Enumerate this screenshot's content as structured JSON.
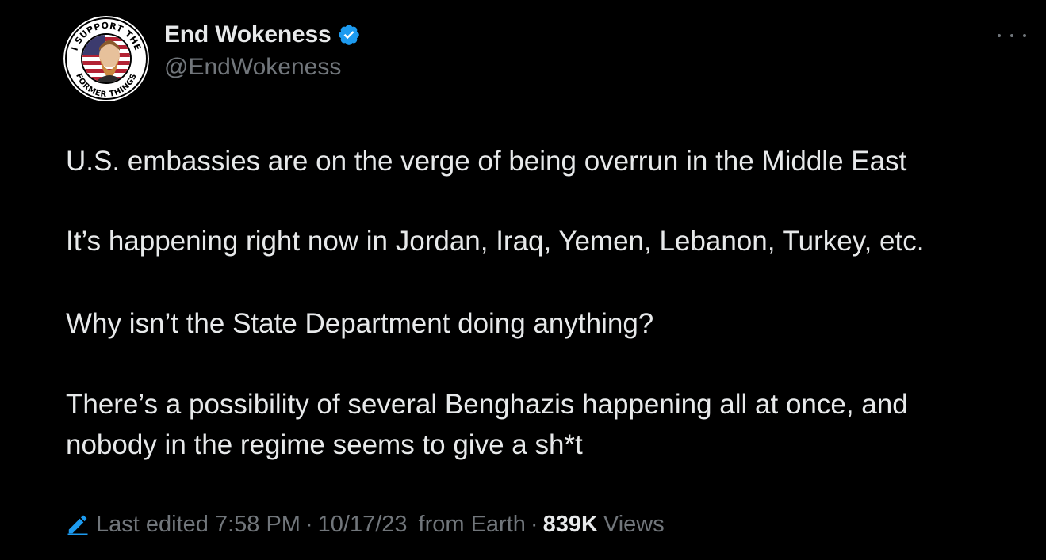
{
  "author": {
    "display_name": "End Wokeness",
    "handle": "@EndWokeness",
    "verified": true,
    "avatar_arc_top": "I SUPPORT THE",
    "avatar_arc_bottom": "FORMER THINGS"
  },
  "tweet": {
    "paragraphs": [
      "U.S. embassies are on the verge of being overrun in the Middle East",
      "It’s happening right now in Jordan, Iraq, Yemen, Lebanon, Turkey, etc.",
      "Why isn’t the State Department doing anything?"
    ],
    "paragraph_4_lines": [
      "There’s a possibility of several Benghazis happening all at once, and",
      "nobody in the regime seems to give a sh*t"
    ]
  },
  "meta": {
    "edited_label": "Last edited 7:58 PM",
    "separator": "·",
    "date": "10/17/23",
    "location": "from Earth",
    "views_count": "839K",
    "views_label": "Views"
  },
  "icons": {
    "verified": "verified-badge-icon",
    "more": "more-options-icon",
    "edit": "edit-pencil-icon"
  },
  "colors": {
    "background": "#000000",
    "primary_text": "#e7e9ea",
    "secondary_text": "#71767b",
    "accent_blue": "#1d9bf0"
  }
}
